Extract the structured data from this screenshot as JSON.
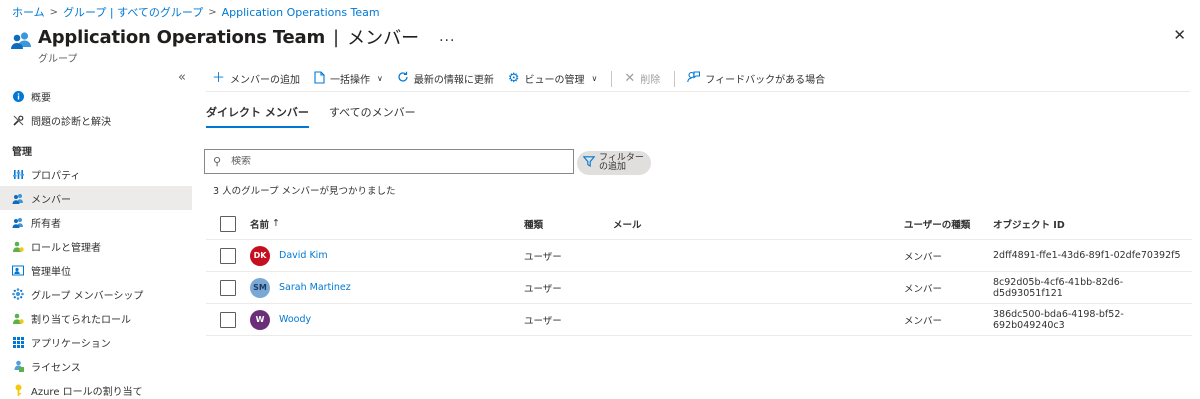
{
  "breadcrumb": {
    "items": [
      "ホーム",
      "グループ | すべてのグループ",
      "Application Operations Team"
    ],
    "separator": ">"
  },
  "header": {
    "title": "Application Operations Team",
    "title_separator": "|",
    "section": "メンバー",
    "more": "...",
    "subtitle": "グループ",
    "close": "✕"
  },
  "sidebar": {
    "collapse": "«",
    "top_items": [
      {
        "label": "概要",
        "icon": "info-icon"
      },
      {
        "label": "問題の診断と解決",
        "icon": "wrench-icon"
      }
    ],
    "section_label": "管理",
    "items": [
      {
        "label": "プロパティ",
        "icon": "properties-icon"
      },
      {
        "label": "メンバー",
        "icon": "members-icon",
        "active": true
      },
      {
        "label": "所有者",
        "icon": "owners-icon"
      },
      {
        "label": "ロールと管理者",
        "icon": "roles-icon"
      },
      {
        "label": "管理単位",
        "icon": "admin-units-icon"
      },
      {
        "label": "グループ メンバーシップ",
        "icon": "group-membership-icon"
      },
      {
        "label": "割り当てられたロール",
        "icon": "assigned-roles-icon"
      },
      {
        "label": "アプリケーション",
        "icon": "apps-grid-icon"
      },
      {
        "label": "ライセンス",
        "icon": "license-icon"
      },
      {
        "label": "Azure ロールの割り当て",
        "icon": "key-icon"
      }
    ]
  },
  "toolbar": {
    "add_member": "メンバーの追加",
    "bulk": "一括操作",
    "refresh": "最新の情報に更新",
    "manage_view": "ビューの管理",
    "delete": "削除",
    "feedback": "フィードバックがある場合"
  },
  "tabs": {
    "direct": "ダイレクト メンバー",
    "all": "すべてのメンバー"
  },
  "search": {
    "placeholder": "検索"
  },
  "filter": {
    "label": "フィルターの追加"
  },
  "results_text": "3 人のグループ メンバーが見つかりました",
  "table": {
    "headers": {
      "name": "名前",
      "sort_indicator": "↑",
      "type": "種類",
      "mail": "メール",
      "user_type": "ユーザーの種類",
      "object_id": "オブジェクト ID"
    },
    "rows": [
      {
        "initials": "DK",
        "avatar_color": "#c50f1f",
        "name": "David Kim",
        "type": "ユーザー",
        "mail": "",
        "user_type": "メンバー",
        "object_id": "2dff4891-ffe1-43d6-89f1-02dfe70392f5"
      },
      {
        "initials": "SM",
        "avatar_color": "#7ba7d6",
        "name": "Sarah Martinez",
        "type": "ユーザー",
        "mail": "",
        "user_type": "メンバー",
        "object_id": "8c92d05b-4cf6-41bb-82d6-d5d93051f121"
      },
      {
        "initials": "W",
        "avatar_color": "#6b2f7a",
        "name": "Woody",
        "type": "ユーザー",
        "mail": "",
        "user_type": "メンバー",
        "object_id": "386dc500-bda6-4198-bf52-692b049240c3"
      }
    ]
  },
  "colors": {
    "accent": "#0078d4",
    "active_nav": "#edebe9"
  }
}
